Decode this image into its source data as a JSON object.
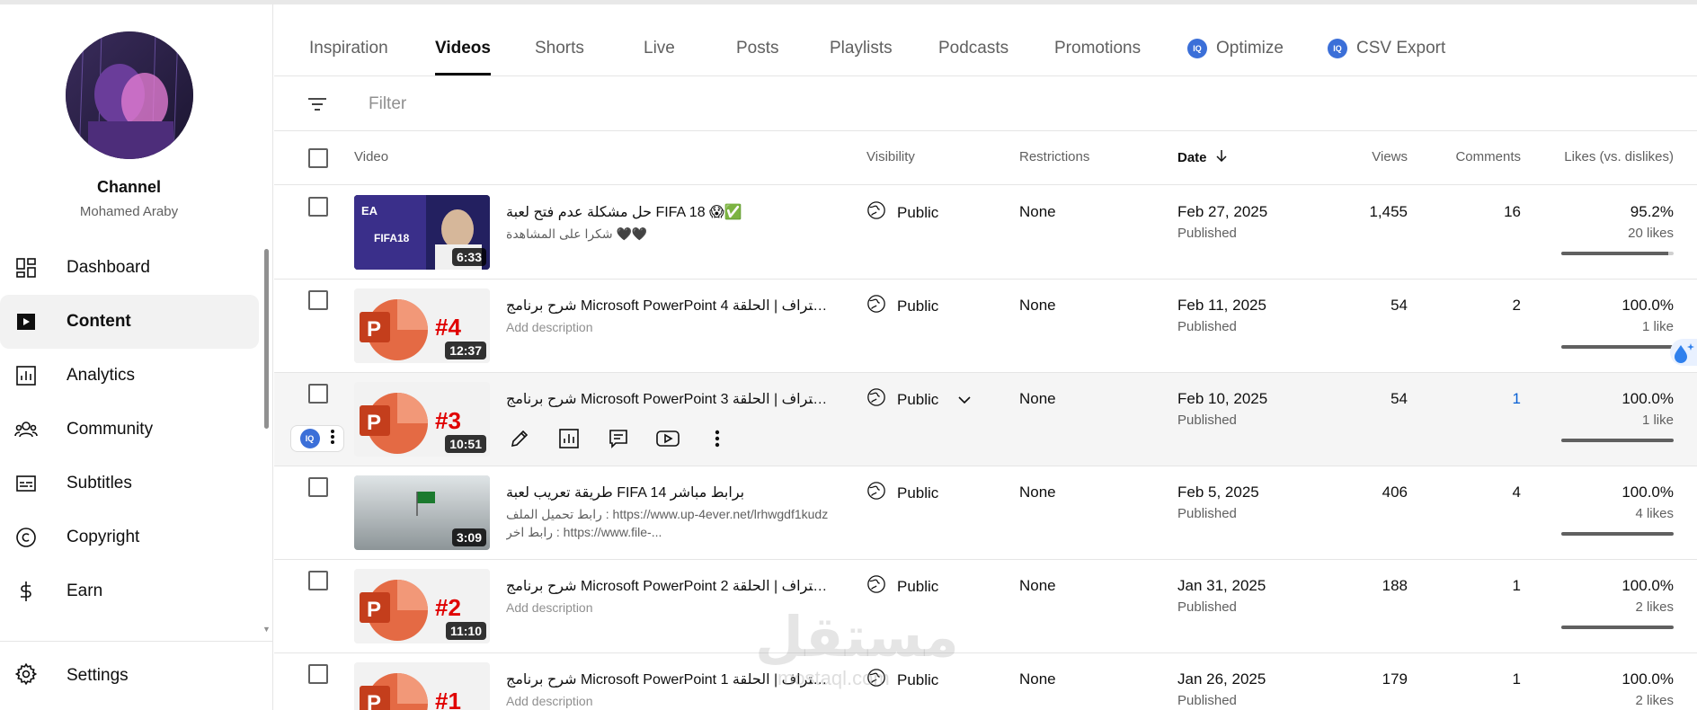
{
  "channel": {
    "title": "Channel",
    "name": "Mohamed Araby"
  },
  "nav": {
    "items": [
      {
        "label": "Dashboard",
        "icon": "dashboard-icon"
      },
      {
        "label": "Content",
        "icon": "content-icon"
      },
      {
        "label": "Analytics",
        "icon": "analytics-icon"
      },
      {
        "label": "Community",
        "icon": "community-icon"
      },
      {
        "label": "Subtitles",
        "icon": "subtitles-icon"
      },
      {
        "label": "Copyright",
        "icon": "copyright-icon"
      },
      {
        "label": "Earn",
        "icon": "earn-icon"
      }
    ],
    "active": "Content",
    "settings_label": "Settings"
  },
  "tabs": [
    {
      "label": "Inspiration"
    },
    {
      "label": "Videos"
    },
    {
      "label": "Shorts"
    },
    {
      "label": "Live"
    },
    {
      "label": "Posts"
    },
    {
      "label": "Playlists"
    },
    {
      "label": "Podcasts"
    },
    {
      "label": "Promotions"
    },
    {
      "label": "Optimize",
      "badge": "IQ"
    },
    {
      "label": "CSV Export",
      "badge": "IQ"
    }
  ],
  "active_tab": "Videos",
  "filter": {
    "placeholder": "Filter"
  },
  "columns": {
    "video": "Video",
    "visibility": "Visibility",
    "restrictions": "Restrictions",
    "date": "Date",
    "views": "Views",
    "comments": "Comments",
    "likes": "Likes (vs. dislikes)"
  },
  "rows": [
    {
      "title": "حل مشكلة عدم فتح لعبة FIFA 18 😱✅",
      "description": "شكرا على المشاهدة 🖤🖤",
      "duration": "6:33",
      "visibility": "Public",
      "restrictions": "None",
      "date": "Feb 27, 2025",
      "status": "Published",
      "views": "1,455",
      "comments": "16",
      "likes_pct": "95.2%",
      "likes_count": "20 likes",
      "like_ratio": 0.952
    },
    {
      "title": "شرح برنامج Microsoft PowerPoint للاحتراف | الحلقة 4 ...",
      "description": "Add description",
      "duration": "12:37",
      "thumb_number": "#4",
      "visibility": "Public",
      "restrictions": "None",
      "date": "Feb 11, 2025",
      "status": "Published",
      "views": "54",
      "comments": "2",
      "likes_pct": "100.0%",
      "likes_count": "1 like",
      "like_ratio": 1.0
    },
    {
      "title": "شرح برنامج Microsoft PowerPoint للاحتراف | الحلقة 3 ...",
      "description": "",
      "duration": "10:51",
      "thumb_number": "#3",
      "visibility": "Public",
      "restrictions": "None",
      "date": "Feb 10, 2025",
      "status": "Published",
      "views": "54",
      "comments": "1",
      "likes_pct": "100.0%",
      "likes_count": "1 like",
      "like_ratio": 1.0,
      "hover_badge": "IQ"
    },
    {
      "title": "طريقة تعريب لعبة FIFA 14 برابط مباشر",
      "description": "رابط تحميل الملف : https://www.up-4ever.net/lrhwgdf1kudz رابط اخر : https://www.file-...",
      "duration": "3:09",
      "visibility": "Public",
      "restrictions": "None",
      "date": "Feb 5, 2025",
      "status": "Published",
      "views": "406",
      "comments": "4",
      "likes_pct": "100.0%",
      "likes_count": "4 likes",
      "like_ratio": 1.0
    },
    {
      "title": "شرح برنامج Microsoft PowerPoint للاحتراف | الحلقة 2 ...",
      "description": "Add description",
      "duration": "11:10",
      "thumb_number": "#2",
      "visibility": "Public",
      "restrictions": "None",
      "date": "Jan 31, 2025",
      "status": "Published",
      "views": "188",
      "comments": "1",
      "likes_pct": "100.0%",
      "likes_count": "2 likes",
      "like_ratio": 1.0
    },
    {
      "title": "شرح برنامج Microsoft PowerPoint للاحتراف | الحلقة 1 ...",
      "description": "Add description",
      "duration": "",
      "thumb_number": "#1",
      "visibility": "Public",
      "restrictions": "None",
      "date": "Jan 26, 2025",
      "status": "Published",
      "views": "179",
      "comments": "1",
      "likes_pct": "100.0%",
      "likes_count": "2 likes",
      "like_ratio": 1.0
    }
  ],
  "watermark": {
    "text": "مستقل",
    "sub": "mostaql.com"
  },
  "colors": {
    "accent_blue": "#065fd4",
    "ppt_orange": "#e05a33",
    "ppt_red": "#c43e1c",
    "iq_blue": "#3b6fd8"
  }
}
